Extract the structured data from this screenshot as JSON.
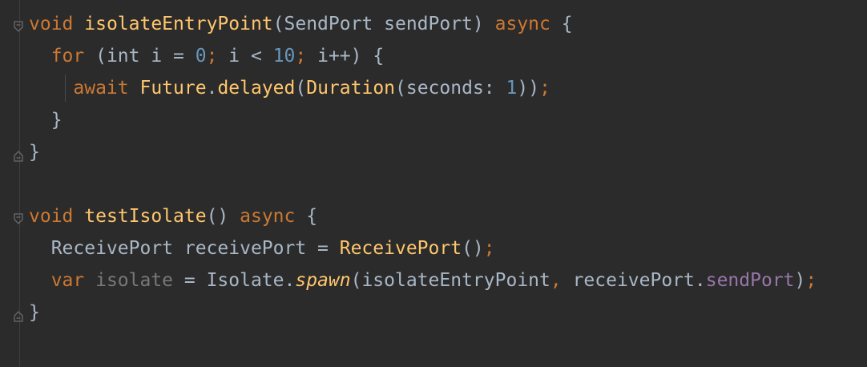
{
  "code_lines": [
    {
      "tokens": [
        {
          "t": "void ",
          "c": "kw"
        },
        {
          "t": "isolateEntryPoint",
          "c": "fn"
        },
        {
          "t": "(SendPort sendPort) ",
          "c": "txt"
        },
        {
          "t": "async",
          "c": "kw"
        },
        {
          "t": " {",
          "c": "txt"
        }
      ]
    },
    {
      "tokens": [
        {
          "t": "  ",
          "c": "txt"
        },
        {
          "t": "for",
          "c": "kw"
        },
        {
          "t": " (int i = ",
          "c": "txt"
        },
        {
          "t": "0",
          "c": "num"
        },
        {
          "t": "; ",
          "c": "kw"
        },
        {
          "t": "i < ",
          "c": "txt"
        },
        {
          "t": "10",
          "c": "num"
        },
        {
          "t": "; ",
          "c": "kw"
        },
        {
          "t": "i++) {",
          "c": "txt"
        }
      ]
    },
    {
      "tokens": [
        {
          "t": "    ",
          "c": "txt"
        },
        {
          "t": "await ",
          "c": "kw"
        },
        {
          "t": "Future",
          "c": "fn"
        },
        {
          "t": ".",
          "c": "txt"
        },
        {
          "t": "delayed",
          "c": "fn"
        },
        {
          "t": "(",
          "c": "txt"
        },
        {
          "t": "Duration",
          "c": "fn"
        },
        {
          "t": "(seconds: ",
          "c": "txt"
        },
        {
          "t": "1",
          "c": "num"
        },
        {
          "t": "))",
          "c": "txt"
        },
        {
          "t": ";",
          "c": "kw"
        }
      ]
    },
    {
      "tokens": [
        {
          "t": "  }",
          "c": "txt"
        }
      ]
    },
    {
      "tokens": [
        {
          "t": "}",
          "c": "txt"
        }
      ]
    },
    {
      "tokens": [
        {
          "t": "",
          "c": "txt"
        }
      ]
    },
    {
      "tokens": [
        {
          "t": "void ",
          "c": "kw"
        },
        {
          "t": "testIsolate",
          "c": "fn"
        },
        {
          "t": "() ",
          "c": "txt"
        },
        {
          "t": "async",
          "c": "kw"
        },
        {
          "t": " {",
          "c": "txt"
        }
      ]
    },
    {
      "tokens": [
        {
          "t": "  ReceivePort receivePort = ",
          "c": "txt"
        },
        {
          "t": "ReceivePort",
          "c": "fn"
        },
        {
          "t": "()",
          "c": "txt"
        },
        {
          "t": ";",
          "c": "kw"
        }
      ]
    },
    {
      "tokens": [
        {
          "t": "  ",
          "c": "txt"
        },
        {
          "t": "var ",
          "c": "kw"
        },
        {
          "t": "isolate",
          "c": "dim"
        },
        {
          "t": " = Isolate.",
          "c": "txt"
        },
        {
          "t": "spawn",
          "c": "it"
        },
        {
          "t": "(isolateEntryPoint",
          "c": "txt"
        },
        {
          "t": ", ",
          "c": "kw"
        },
        {
          "t": "receivePort.",
          "c": "txt"
        },
        {
          "t": "sendPort",
          "c": "prop"
        },
        {
          "t": ")",
          "c": "txt"
        },
        {
          "t": ";",
          "c": "kw"
        }
      ]
    },
    {
      "tokens": [
        {
          "t": "}",
          "c": "txt"
        }
      ]
    }
  ],
  "colors": {
    "background": "#2b2b2b",
    "keyword": "#cc7832",
    "function": "#ffc66d",
    "number": "#6897bb",
    "text": "#a9b7c6",
    "unused": "#787878",
    "property": "#9876aa"
  },
  "fold_markers": [
    {
      "line": 0,
      "icon": "fold-open-icon"
    },
    {
      "line": 4,
      "icon": "fold-close-icon"
    },
    {
      "line": 6,
      "icon": "fold-open-icon"
    },
    {
      "line": 9,
      "icon": "fold-close-icon"
    }
  ]
}
